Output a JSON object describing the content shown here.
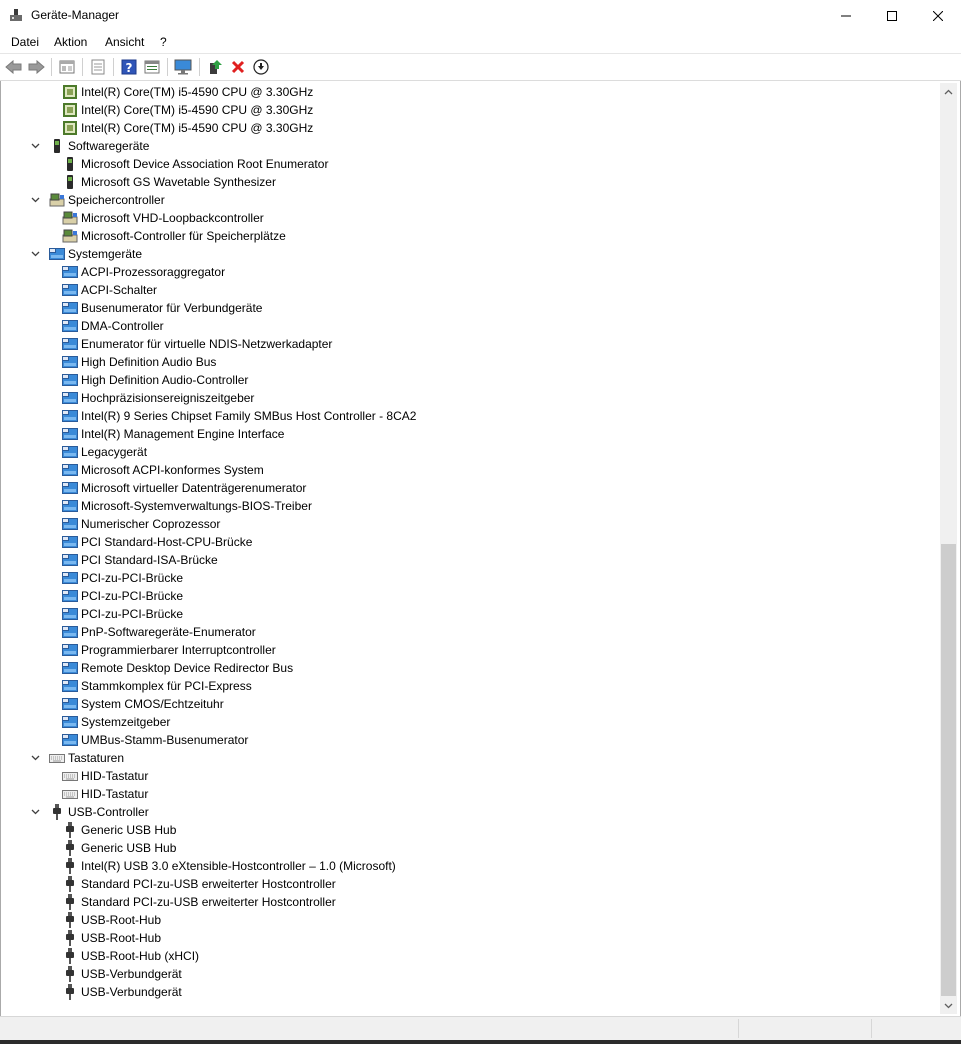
{
  "window": {
    "title": "Geräte-Manager"
  },
  "menu": [
    "Datei",
    "Aktion",
    "Ansicht",
    "?"
  ],
  "toolbar": [
    {
      "name": "back-icon"
    },
    {
      "name": "forward-icon"
    },
    {
      "sep": true
    },
    {
      "name": "properties-icon"
    },
    {
      "sep": true
    },
    {
      "name": "driver-icon"
    },
    {
      "sep": true
    },
    {
      "name": "help-icon"
    },
    {
      "name": "view-icon"
    },
    {
      "sep": true
    },
    {
      "name": "monitor-icon"
    },
    {
      "sep": true
    },
    {
      "name": "update-driver-icon"
    },
    {
      "name": "uninstall-icon"
    },
    {
      "name": "download-icon"
    }
  ],
  "tree": [
    {
      "level": 1,
      "icon": "cpu",
      "label": "Intel(R) Core(TM) i5-4590 CPU @ 3.30GHz"
    },
    {
      "level": 1,
      "icon": "cpu",
      "label": "Intel(R) Core(TM) i5-4590 CPU @ 3.30GHz"
    },
    {
      "level": 1,
      "icon": "cpu",
      "label": "Intel(R) Core(TM) i5-4590 CPU @ 3.30GHz"
    },
    {
      "level": 0,
      "icon": "software",
      "label": "Softwaregeräte"
    },
    {
      "level": 1,
      "icon": "software",
      "label": "Microsoft Device Association Root Enumerator"
    },
    {
      "level": 1,
      "icon": "software",
      "label": "Microsoft GS Wavetable Synthesizer"
    },
    {
      "level": 0,
      "icon": "storage",
      "label": "Speichercontroller"
    },
    {
      "level": 1,
      "icon": "storage",
      "label": "Microsoft VHD-Loopbackcontroller"
    },
    {
      "level": 1,
      "icon": "storage",
      "label": "Microsoft-Controller für Speicherplätze"
    },
    {
      "level": 0,
      "icon": "system",
      "label": "Systemgeräte"
    },
    {
      "level": 1,
      "icon": "system",
      "label": "ACPI-Prozessoraggregator"
    },
    {
      "level": 1,
      "icon": "system",
      "label": "ACPI-Schalter"
    },
    {
      "level": 1,
      "icon": "system",
      "label": "Busenumerator für Verbundgeräte"
    },
    {
      "level": 1,
      "icon": "system",
      "label": "DMA-Controller"
    },
    {
      "level": 1,
      "icon": "system",
      "label": "Enumerator für virtuelle NDIS-Netzwerkadapter"
    },
    {
      "level": 1,
      "icon": "system",
      "label": "High Definition Audio Bus"
    },
    {
      "level": 1,
      "icon": "system",
      "label": "High Definition Audio-Controller"
    },
    {
      "level": 1,
      "icon": "system",
      "label": "Hochpräzisionsereigniszeitgeber"
    },
    {
      "level": 1,
      "icon": "system",
      "label": "Intel(R) 9 Series Chipset Family SMBus Host Controller - 8CA2"
    },
    {
      "level": 1,
      "icon": "system",
      "label": "Intel(R) Management Engine Interface"
    },
    {
      "level": 1,
      "icon": "system",
      "label": "Legacygerät"
    },
    {
      "level": 1,
      "icon": "system",
      "label": "Microsoft ACPI-konformes System"
    },
    {
      "level": 1,
      "icon": "system",
      "label": "Microsoft virtueller Datenträgerenumerator"
    },
    {
      "level": 1,
      "icon": "system",
      "label": "Microsoft-Systemverwaltungs-BIOS-Treiber"
    },
    {
      "level": 1,
      "icon": "system",
      "label": "Numerischer Coprozessor"
    },
    {
      "level": 1,
      "icon": "system",
      "label": "PCI Standard-Host-CPU-Brücke"
    },
    {
      "level": 1,
      "icon": "system",
      "label": "PCI Standard-ISA-Brücke"
    },
    {
      "level": 1,
      "icon": "system",
      "label": "PCI-zu-PCI-Brücke"
    },
    {
      "level": 1,
      "icon": "system",
      "label": "PCI-zu-PCI-Brücke"
    },
    {
      "level": 1,
      "icon": "system",
      "label": "PCI-zu-PCI-Brücke"
    },
    {
      "level": 1,
      "icon": "system",
      "label": "PnP-Softwaregeräte-Enumerator"
    },
    {
      "level": 1,
      "icon": "system",
      "label": "Programmierbarer Interruptcontroller"
    },
    {
      "level": 1,
      "icon": "system",
      "label": "Remote Desktop Device Redirector Bus"
    },
    {
      "level": 1,
      "icon": "system",
      "label": "Stammkomplex für PCI-Express"
    },
    {
      "level": 1,
      "icon": "system",
      "label": "System CMOS/Echtzeituhr"
    },
    {
      "level": 1,
      "icon": "system",
      "label": "Systemzeitgeber"
    },
    {
      "level": 1,
      "icon": "system",
      "label": "UMBus-Stamm-Busenumerator"
    },
    {
      "level": 0,
      "icon": "keyboard",
      "label": "Tastaturen"
    },
    {
      "level": 1,
      "icon": "keyboard",
      "label": "HID-Tastatur"
    },
    {
      "level": 1,
      "icon": "keyboard",
      "label": "HID-Tastatur"
    },
    {
      "level": 0,
      "icon": "usb",
      "label": "USB-Controller"
    },
    {
      "level": 1,
      "icon": "usb",
      "label": "Generic USB Hub"
    },
    {
      "level": 1,
      "icon": "usb",
      "label": "Generic USB Hub"
    },
    {
      "level": 1,
      "icon": "usb",
      "label": "Intel(R) USB 3.0 eXtensible-Hostcontroller – 1.0 (Microsoft)"
    },
    {
      "level": 1,
      "icon": "usb",
      "label": "Standard PCI-zu-USB erweiterter Hostcontroller"
    },
    {
      "level": 1,
      "icon": "usb",
      "label": "Standard PCI-zu-USB erweiterter Hostcontroller"
    },
    {
      "level": 1,
      "icon": "usb",
      "label": "USB-Root-Hub"
    },
    {
      "level": 1,
      "icon": "usb",
      "label": "USB-Root-Hub"
    },
    {
      "level": 1,
      "icon": "usb",
      "label": "USB-Root-Hub (xHCI)"
    },
    {
      "level": 1,
      "icon": "usb",
      "label": "USB-Verbundgerät"
    },
    {
      "level": 1,
      "icon": "usb",
      "label": "USB-Verbundgerät"
    }
  ]
}
